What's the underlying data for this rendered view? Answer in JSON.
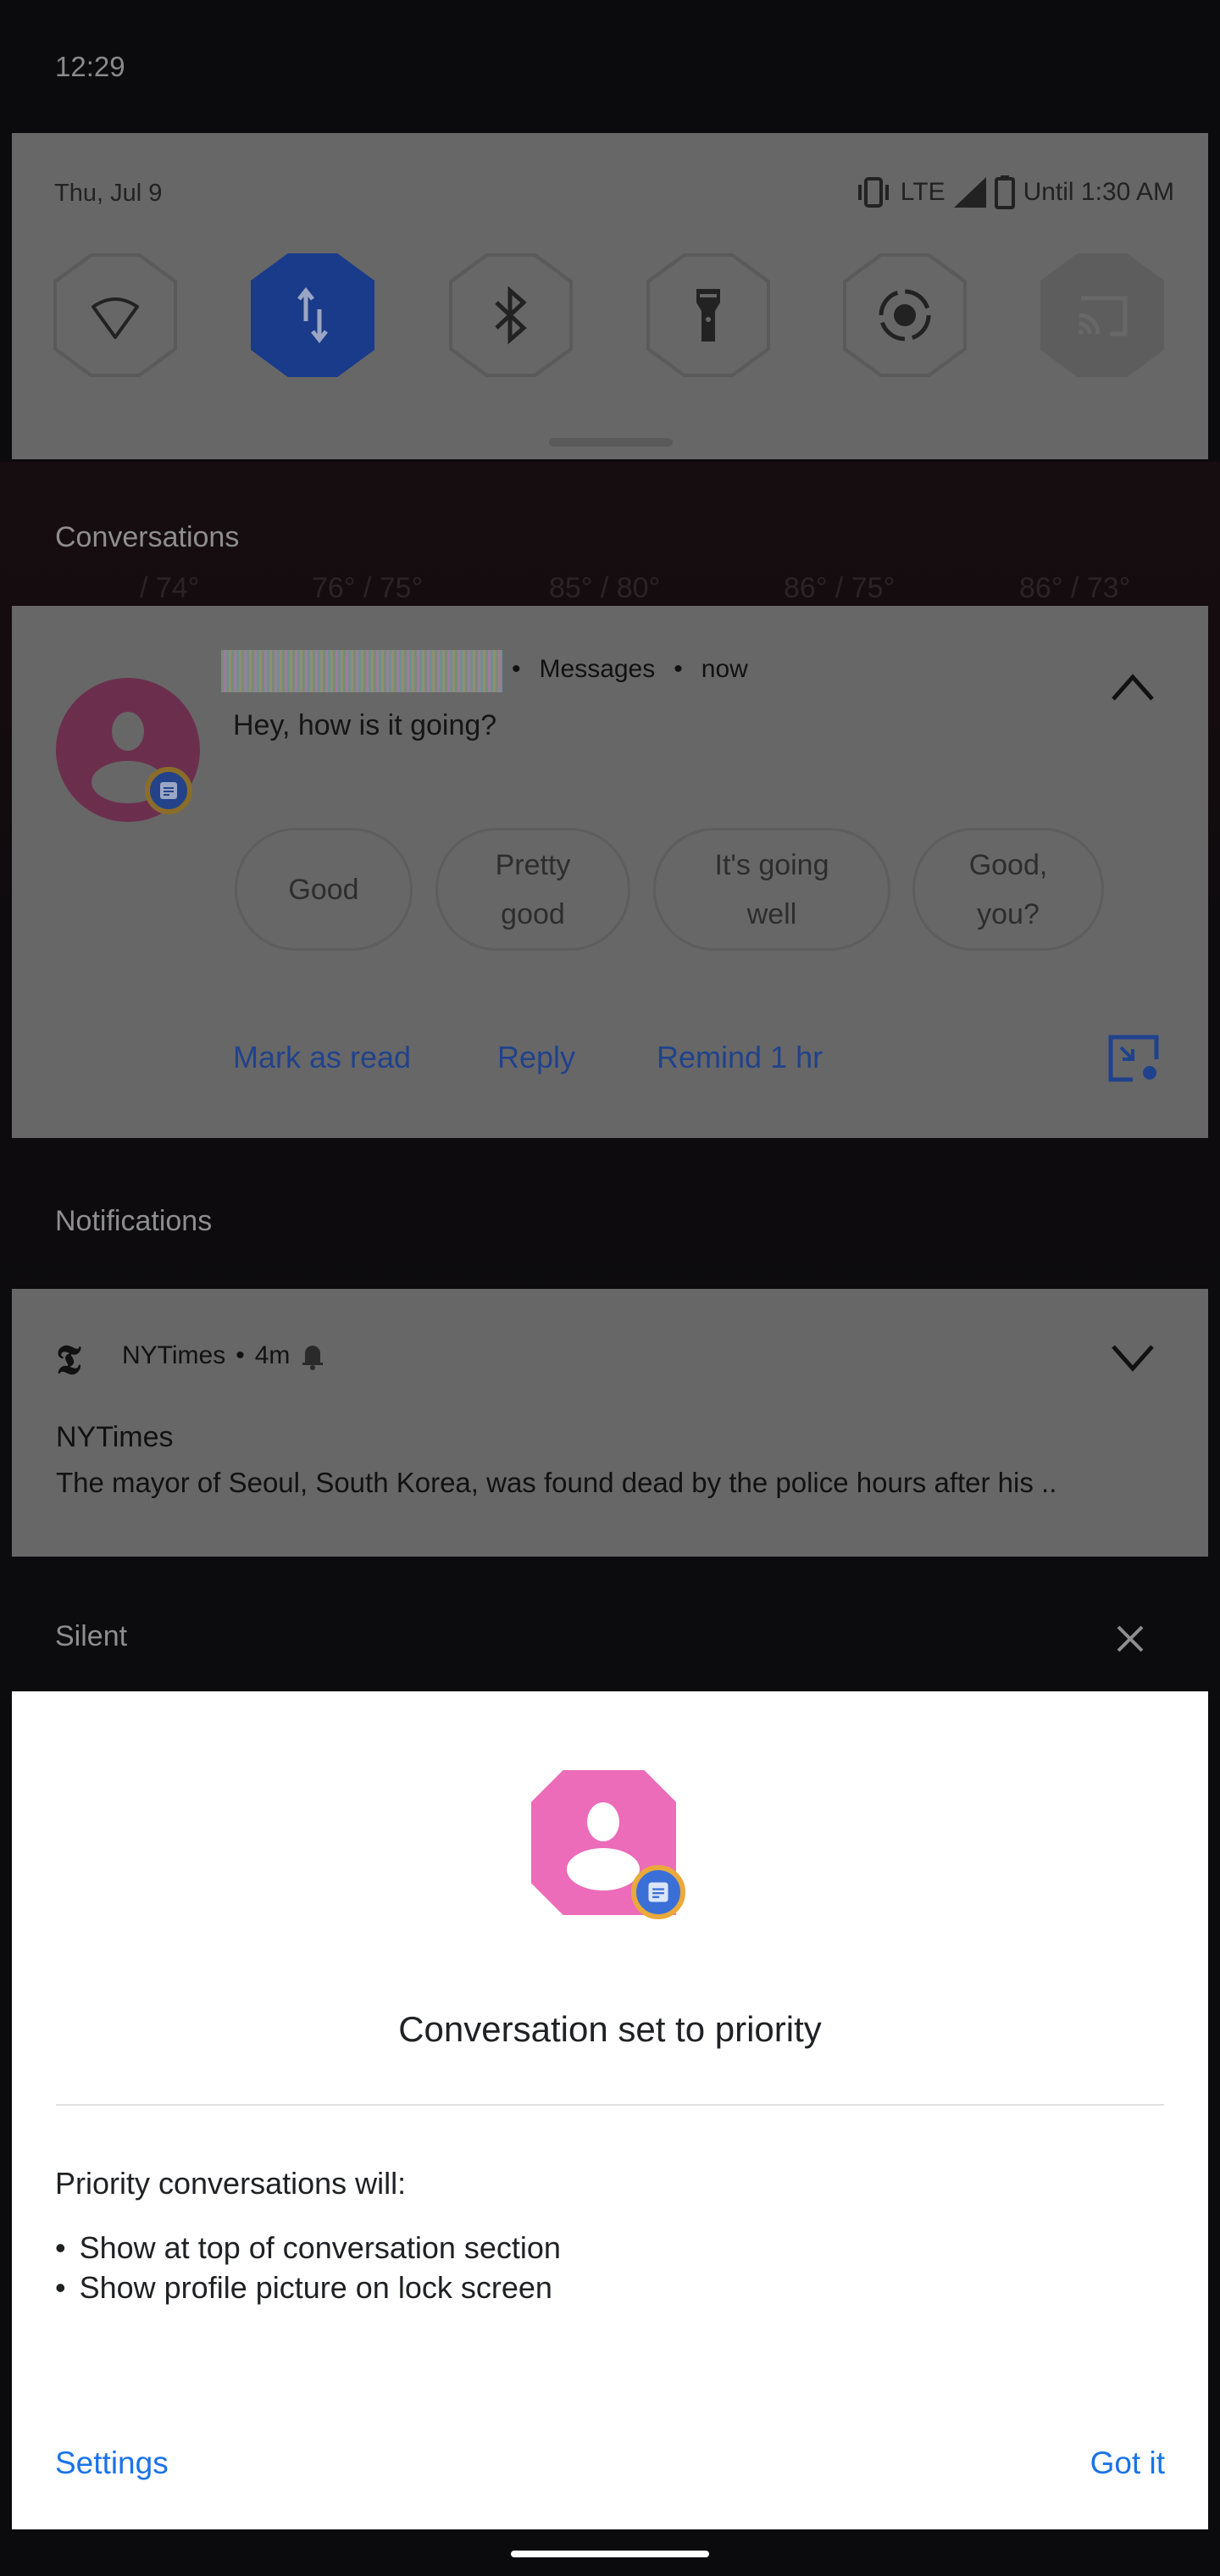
{
  "status_bar": {
    "time": "12:29"
  },
  "quick_settings": {
    "date": "Thu, Jul 9",
    "network": "LTE",
    "battery_text": "Until 1:30 AM",
    "tiles": [
      {
        "name": "wifi",
        "active": false
      },
      {
        "name": "mobile-data",
        "active": true
      },
      {
        "name": "bluetooth",
        "active": false
      },
      {
        "name": "flashlight",
        "active": false
      },
      {
        "name": "auto-rotate",
        "active": false
      },
      {
        "name": "cast",
        "active": false,
        "disabled": true
      }
    ],
    "accent": "#1a3a8a"
  },
  "wallpaper_weather": [
    "/ 74°",
    "76° / 75°",
    "85° / 80°",
    "86° / 75°",
    "86° / 73°"
  ],
  "conversations": {
    "header": "Conversations",
    "notification": {
      "app": "Messages",
      "time": "now",
      "message": "Hey, how is it going?",
      "smart_replies": [
        [
          "Good"
        ],
        [
          "Pretty",
          "good"
        ],
        [
          "It's going",
          "well"
        ],
        [
          "Good,",
          "you?"
        ]
      ],
      "actions": {
        "mark_read": "Mark as read",
        "reply": "Reply",
        "remind": "Remind 1 hr"
      }
    }
  },
  "notifications": {
    "header": "Notifications",
    "item": {
      "app": "NYTimes",
      "time": "4m",
      "title": "NYTimes",
      "body": "The mayor of Seoul, South Korea, was found dead by the police hours after his .."
    }
  },
  "silent": {
    "header": "Silent"
  },
  "priority_sheet": {
    "title": "Conversation set to priority",
    "intro": "Priority conversations will:",
    "bullets": [
      "Show at top of conversation section",
      "Show profile picture on lock screen"
    ],
    "settings_label": "Settings",
    "got_it_label": "Got it",
    "avatar_color": "#ec6cb9",
    "link_color": "#1a73e8"
  }
}
